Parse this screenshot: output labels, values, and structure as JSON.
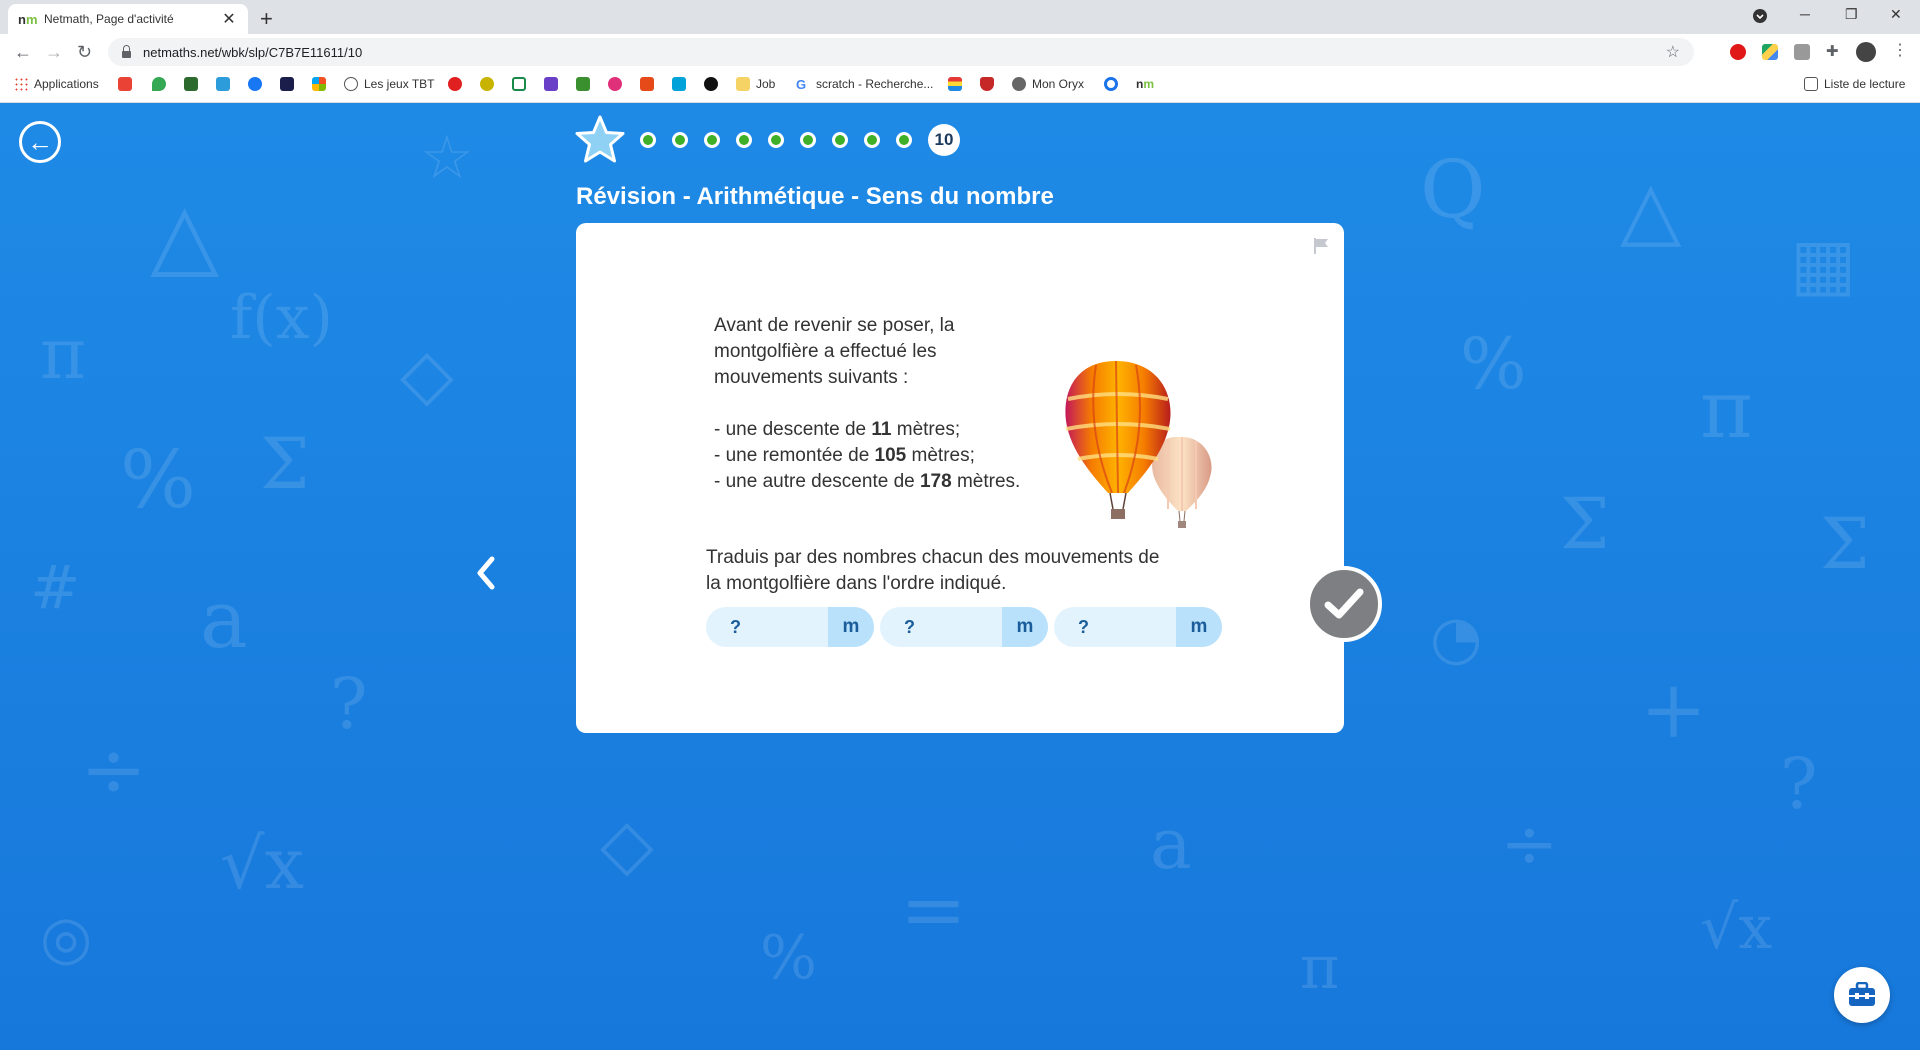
{
  "browser": {
    "tab_title": "Netmath, Page d'activité",
    "url": "netmaths.net/wbk/slp/C7B7E11611/10",
    "bookmarks": [
      {
        "label": "Applications"
      },
      {
        "label": "Les jeux TBT"
      },
      {
        "label": "Job"
      },
      {
        "label": "scratch - Recherche..."
      },
      {
        "label": "Mon Oryx"
      }
    ],
    "reading_list": "Liste de lecture"
  },
  "activity": {
    "current_step": "10",
    "completed_steps": 9,
    "title": "Révision - Arithmétique - Sens du nombre",
    "intro_line1": "Avant de revenir se poser, la",
    "intro_line2": "montgolfière a effectué les",
    "intro_line3": "mouvements suivants :",
    "move1_prefix": "- une descente de ",
    "move1_value": "11",
    "move1_suffix": " mètres;",
    "move2_prefix": "- une remontée de ",
    "move2_value": "105",
    "move2_suffix": " mètres;",
    "move3_prefix": "- une autre descente de ",
    "move3_value": "178",
    "move3_suffix": " mètres.",
    "instruction_line1": "Traduis par des nombres chacun des mouvements de",
    "instruction_line2": "la montgolfière dans l'ordre indiqué.",
    "answers": [
      {
        "placeholder": "?",
        "unit": "m"
      },
      {
        "placeholder": "?",
        "unit": "m"
      },
      {
        "placeholder": "?",
        "unit": "m"
      }
    ]
  }
}
